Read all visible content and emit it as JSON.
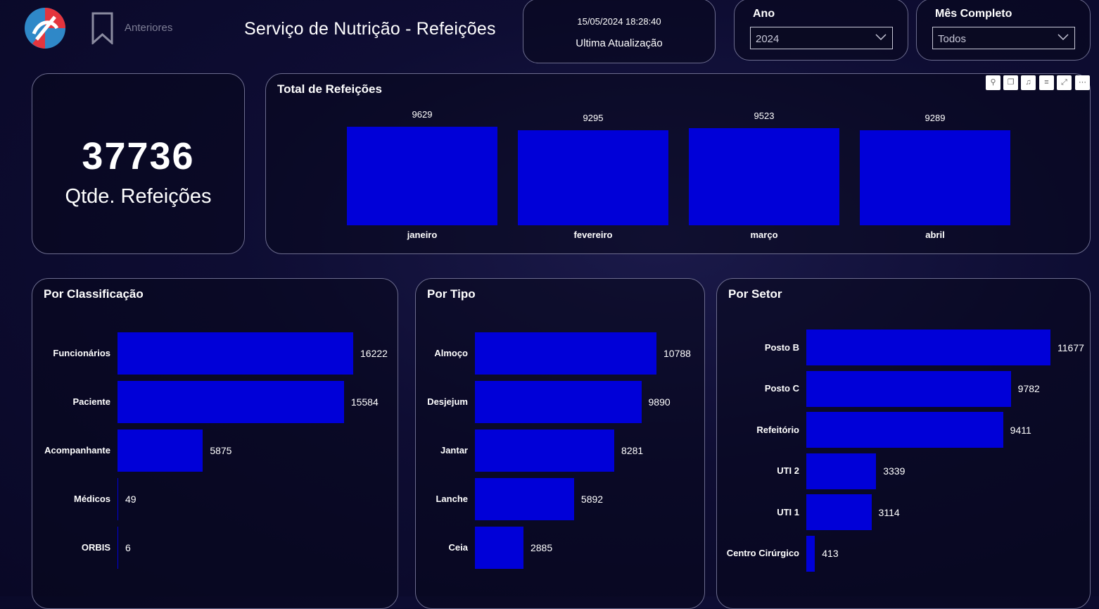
{
  "header": {
    "anteriores_label": "Anteriores",
    "title": "Serviço de Nutrição - Refeições",
    "updated_at": "15/05/2024 18:28:40",
    "updated_label": "Ultima Atualização"
  },
  "filters": {
    "year": {
      "label": "Ano",
      "value": "2024"
    },
    "month": {
      "label": "Mês Completo",
      "value": "Todos"
    }
  },
  "kpi": {
    "value": "37736",
    "label": "Qtde. Refeições"
  },
  "icons": [
    "logo-icon",
    "bookmark-icon",
    "pin-icon",
    "copy-icon",
    "bell-icon",
    "filter-icon",
    "focus-mode-icon",
    "more-options-icon",
    "chevron-down-icon"
  ],
  "colors": {
    "bar": "#0000d8",
    "background": "#0e0d33",
    "border": "#6c6c8e"
  },
  "chart_data": [
    {
      "type": "bar",
      "title": "Total de Refeições",
      "categories": [
        "janeiro",
        "fevereiro",
        "março",
        "abril"
      ],
      "values": [
        9629,
        9295,
        9523,
        9289
      ]
    },
    {
      "type": "bar",
      "orientation": "horizontal",
      "title": "Por Classificação",
      "categories": [
        "Funcionários",
        "Paciente",
        "Acompanhante",
        "Médicos",
        "ORBIS"
      ],
      "values": [
        16222,
        15584,
        5875,
        49,
        6
      ]
    },
    {
      "type": "bar",
      "orientation": "horizontal",
      "title": "Por Tipo",
      "categories": [
        "Almoço",
        "Desjejum",
        "Jantar",
        "Lanche",
        "Ceia"
      ],
      "values": [
        10788,
        9890,
        8281,
        5892,
        2885
      ]
    },
    {
      "type": "bar",
      "orientation": "horizontal",
      "title": "Por Setor",
      "categories": [
        "Posto B",
        "Posto C",
        "Refeitório",
        "UTI 2",
        "UTI 1",
        "Centro Cirúrgico"
      ],
      "values": [
        11677,
        9782,
        9411,
        3339,
        3114,
        413
      ]
    }
  ]
}
